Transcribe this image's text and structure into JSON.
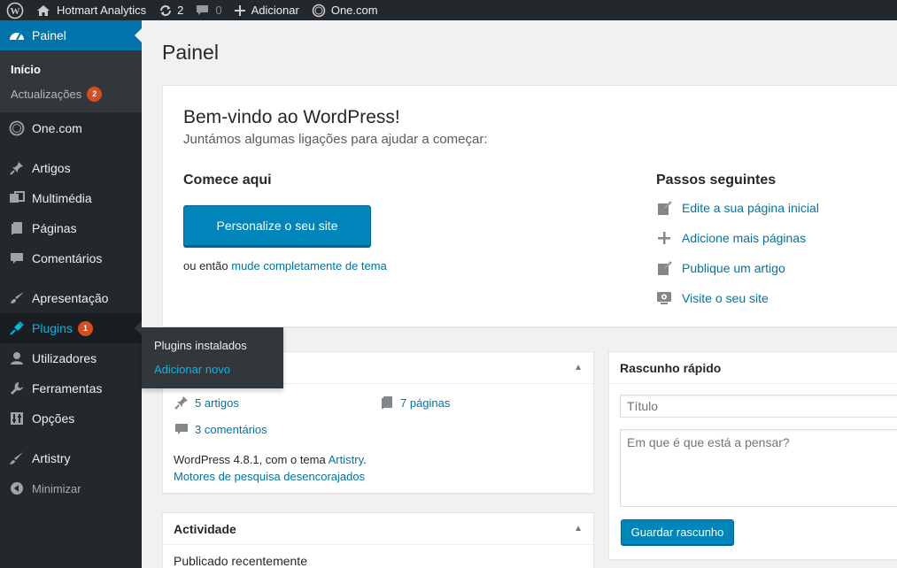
{
  "admin_bar": {
    "site_name": "Hotmart Analytics",
    "updates_count": "2",
    "comments_count": "0",
    "new_label": "Adicionar",
    "onecom_label": "One.com"
  },
  "sidebar": {
    "dashboard": "Painel",
    "home": "Início",
    "updates": "Actualizações",
    "updates_badge": "2",
    "onecom": "One.com",
    "posts": "Artigos",
    "media": "Multimédia",
    "pages": "Páginas",
    "comments": "Comentários",
    "appearance": "Apresentação",
    "plugins": "Plugins",
    "plugins_badge": "1",
    "users": "Utilizadores",
    "tools": "Ferramentas",
    "settings": "Opções",
    "artistry": "Artistry",
    "collapse": "Minimizar"
  },
  "flyout": {
    "installed": "Plugins instalados",
    "add_new": "Adicionar novo"
  },
  "page_title": "Painel",
  "welcome": {
    "title": "Bem-vindo ao WordPress!",
    "subtitle": "Juntámos algumas ligações para ajudar a começar:",
    "start_heading": "Comece aqui",
    "customize_button": "Personalize o seu site",
    "alt_prefix": "ou então",
    "alt_link": "mude completamente de tema",
    "next_heading": "Passos seguintes",
    "next_steps": [
      "Edite a sua página inicial",
      "Adicione mais páginas",
      "Publique um artigo",
      "Visite o seu site"
    ]
  },
  "glance": {
    "posts": "5 artigos",
    "pages": "7 páginas",
    "comments": "3 comentários",
    "version_text": "WordPress 4.8.1, com o tema",
    "theme_link": "Artistry",
    "version_end": ".",
    "search_engines": "Motores de pesquisa desencorajados"
  },
  "activity": {
    "heading": "Actividade",
    "published_recent": "Publicado recentemente"
  },
  "quick_draft": {
    "heading": "Rascunho rápido",
    "title_placeholder": "Título",
    "content_placeholder": "Em que é que está a pensar?",
    "save_button": "Guardar rascunho"
  }
}
